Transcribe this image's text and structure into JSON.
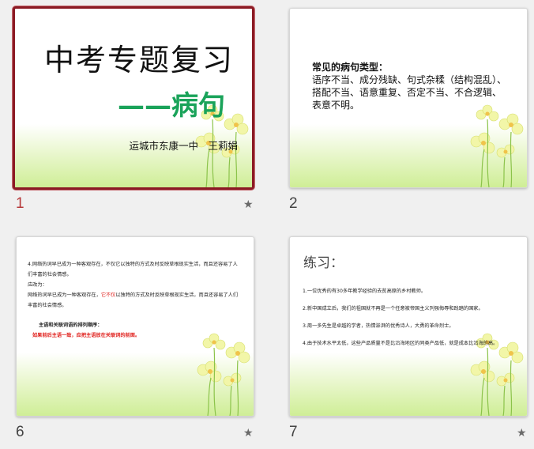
{
  "slides": [
    {
      "number": "1",
      "title": "中考专题复习",
      "subtitle": "——病句",
      "author": "运城市东康一中　王莉娟"
    },
    {
      "number": "2",
      "heading": "常见的病句类型：",
      "body": "语序不当、成分残缺、句式杂糅（结构混乱）、搭配不当、语意重复、否定不当、不合逻辑、表意不明。"
    },
    {
      "number": "6",
      "line1": "4.网络热词早已成为一种客观存在，不仅它以独特的方式及时反映草根现实生活，而且还容易了人们丰富的社会情感。",
      "line2": "应改为：",
      "line3a": "网络热词早已成为一种客观存在，",
      "line3red": "它不仅",
      "line3b": "以独特的方式及时反映草根现实生活，而且还容易了人们丰富的社会情感。",
      "rule_head": "主语和关联词语的排列顺序：",
      "rule_body": "如果前后主语一致，应把主语放在关联词的前面。"
    },
    {
      "number": "7",
      "title": "练习：",
      "items": [
        "1.一位优秀的有30多年教学经验的去贫高原的乡村教师。",
        "2.新中国成立后，我们的祖国就不再是一个任意被帝国主义列强侮辱和践踏的国家。",
        "3.周一多先生是卓越的学者，热情澎湃的优秀诗人，大勇的革命烈士。",
        "4.由于技术水平太低，这些产品质量不是比沿海地区的同类产品低，就是成本比沿海的高。"
      ]
    }
  ],
  "colors": {
    "selected_border": "#8b1a24",
    "active_number": "#b6393a",
    "subtitle_green": "#1aa35a",
    "highlight_red": "#e0201c"
  },
  "icons": [
    "star-icon",
    "flower-icon"
  ]
}
